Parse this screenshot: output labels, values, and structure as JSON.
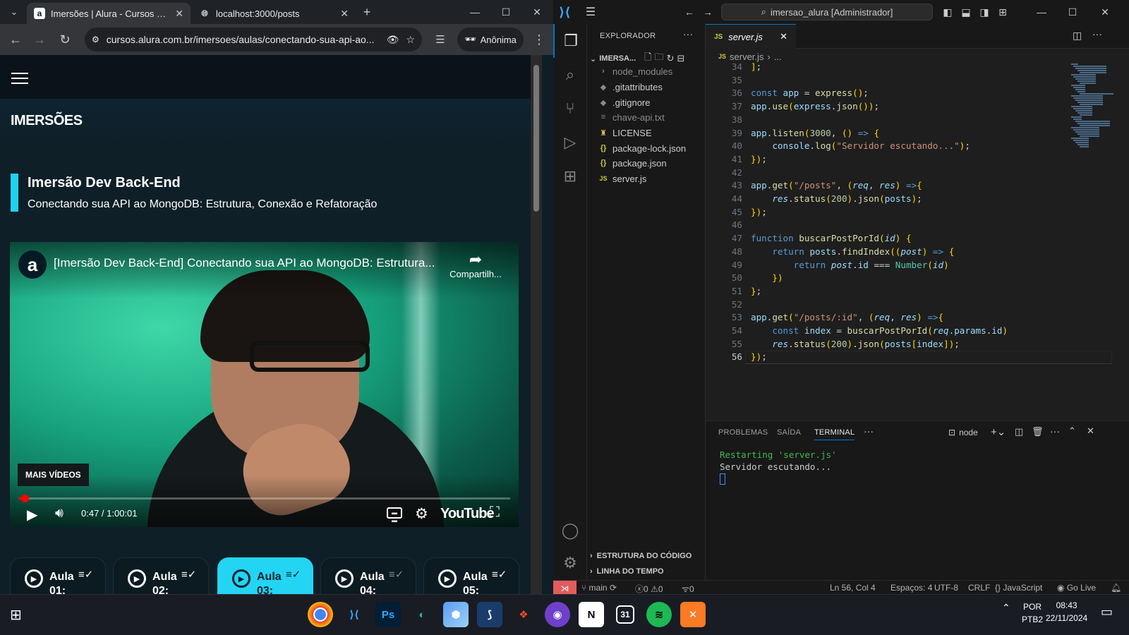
{
  "chrome": {
    "tabs": [
      {
        "title": "Imersões | Alura - Cursos online",
        "favicon": "alura-a-icon",
        "active": true
      },
      {
        "title": "localhost:3000/posts",
        "favicon": "globe-icon",
        "active": false
      }
    ],
    "url": "cursos.alura.com.br/imersoes/aulas/conectando-sua-api-ao...",
    "profile_label": "Anônima"
  },
  "page": {
    "section_title": "IMERSÕES",
    "course_title": "Imersão Dev Back-End",
    "course_subtitle": "Conectando sua API ao MongoDB: Estrutura, Conexão e Refatoração",
    "accent_color": "#21d1ef",
    "video": {
      "title": "[Imersão Dev Back-End] Conectando sua API ao MongoDB: Estrutura...",
      "share_label": "Compartilh...",
      "more_videos_label": "MAIS VÍDEOS",
      "time": "0:47 / 1:00:01",
      "progress_fraction": 0.013,
      "brand": "YouTube"
    },
    "lessons": [
      {
        "label": "Aula 01:",
        "current": false
      },
      {
        "label": "Aula 02:",
        "current": false
      },
      {
        "label": "Aula 03:",
        "current": true
      },
      {
        "label": "Aula 04:",
        "current": false
      },
      {
        "label": "Aula 05:",
        "current": false
      }
    ]
  },
  "vscode": {
    "command_center": "imersao_alura [Administrador]",
    "explorer_title": "EXPLORADOR",
    "root_folder": "IMERSA...",
    "files": [
      {
        "name": "node_modules",
        "icon": "chevron-right-icon",
        "dim": true
      },
      {
        "name": ".gitattributes",
        "icon": "git-icon",
        "dim": false
      },
      {
        "name": ".gitignore",
        "icon": "git-icon",
        "dim": false
      },
      {
        "name": "chave-api.txt",
        "icon": "text-file-icon",
        "dim": true
      },
      {
        "name": "LICENSE",
        "icon": "license-icon",
        "dim": false
      },
      {
        "name": "package-lock.json",
        "icon": "json-icon",
        "dim": false
      },
      {
        "name": "package.json",
        "icon": "json-icon",
        "dim": false
      },
      {
        "name": "server.js",
        "icon": "js-icon",
        "dim": false
      }
    ],
    "outline_label": "ESTRUTURA DO CÓDIGO",
    "timeline_label": "LINHA DO TEMPO",
    "editor_tab": "server.js",
    "breadcrumb": [
      "server.js",
      "..."
    ],
    "code_lines": [
      {
        "n": "34",
        "text": "];"
      },
      {
        "n": "35",
        "text": ""
      },
      {
        "n": "36",
        "text": "const app = express();"
      },
      {
        "n": "37",
        "text": "app.use(express.json());"
      },
      {
        "n": "38",
        "text": ""
      },
      {
        "n": "39",
        "text": "app.listen(3000, () => {"
      },
      {
        "n": "40",
        "text": "    console.log(\"Servidor escutando...\");"
      },
      {
        "n": "41",
        "text": "});"
      },
      {
        "n": "42",
        "text": ""
      },
      {
        "n": "43",
        "text": "app.get(\"/posts\", (req, res) =>{"
      },
      {
        "n": "44",
        "text": "    res.status(200).json(posts);"
      },
      {
        "n": "45",
        "text": "});"
      },
      {
        "n": "46",
        "text": ""
      },
      {
        "n": "47",
        "text": "function buscarPostPorId(id) {"
      },
      {
        "n": "48",
        "text": "    return posts.findIndex((post) => {"
      },
      {
        "n": "49",
        "text": "        return post.id === Number(id)"
      },
      {
        "n": "50",
        "text": "    })"
      },
      {
        "n": "51",
        "text": "};"
      },
      {
        "n": "52",
        "text": ""
      },
      {
        "n": "53",
        "text": "app.get(\"/posts/:id\", (req, res) =>{"
      },
      {
        "n": "54",
        "text": "    const index = buscarPostPorId(req.params.id)"
      },
      {
        "n": "55",
        "text": "    res.status(200).json(posts[index]);"
      },
      {
        "n": "56",
        "text": "});"
      }
    ],
    "current_line": "56",
    "panel_tabs": [
      "PROBLEMAS",
      "SAÍDA",
      "TERMINAL"
    ],
    "active_panel_tab": "TERMINAL",
    "terminal_name": "node",
    "terminal_lines": [
      "Restarting 'server.js'",
      "Servidor escutando..."
    ],
    "status": {
      "branch": "main",
      "errors": "0",
      "warnings": "0",
      "ports": "0",
      "position": "Ln 56, Col 4",
      "spaces": "Espaços: 4",
      "encoding": "UTF-8",
      "eol": "CRLF",
      "language": "JavaScript",
      "golive": "Go Live"
    }
  },
  "taskbar": {
    "apps": [
      "chrome-icon",
      "vscode-icon",
      "photoshop-icon",
      "edge-dev-icon",
      "cube-icon",
      "mysql-workbench-icon",
      "figma-icon",
      "github-desktop-icon",
      "notion-icon",
      "calendar-icon",
      "spotify-icon",
      "xampp-icon"
    ],
    "lang": "POR",
    "layout": "PTB2",
    "time": "08:43",
    "date": "22/11/2024"
  }
}
